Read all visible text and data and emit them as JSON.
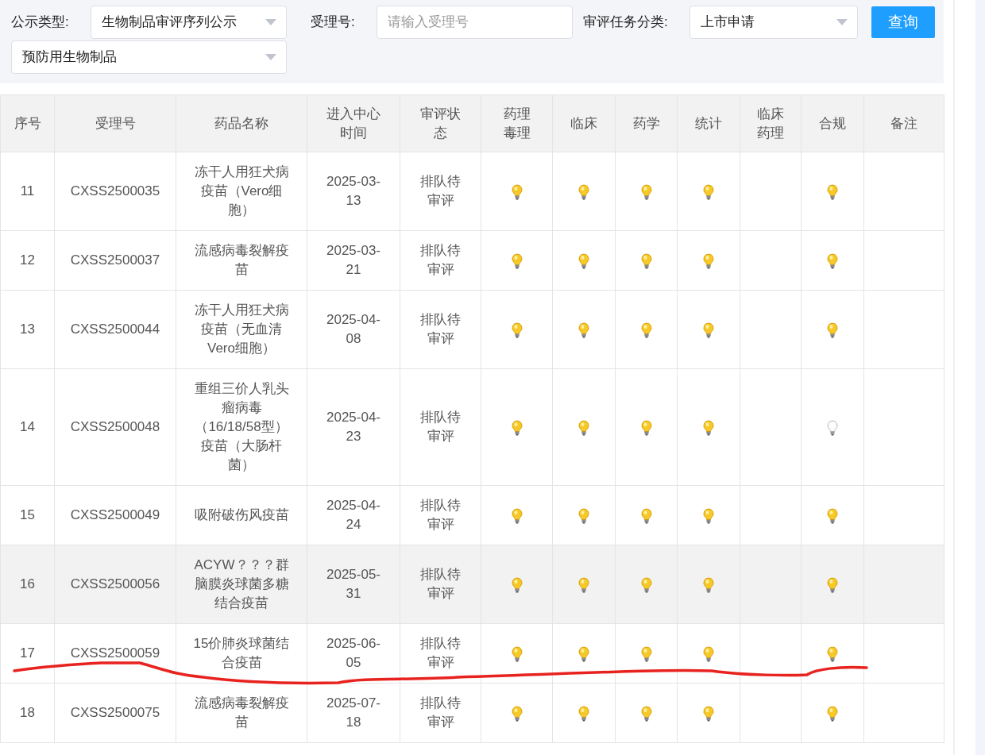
{
  "filters": {
    "notice_type": {
      "label": "公示类型:",
      "value": "生物制品审评序列公示"
    },
    "acceptance_no": {
      "label": "受理号:",
      "placeholder": "请输入受理号"
    },
    "task_category": {
      "label": "审评任务分类:",
      "value": "上市申请"
    },
    "search_button": "查询",
    "subcategory": {
      "value": "预防用生物制品"
    }
  },
  "table": {
    "columns": [
      "序号",
      "受理号",
      "药品名称",
      "进入中心时间",
      "审评状态",
      "药理毒理",
      "临床",
      "药学",
      "统计",
      "临床药理",
      "合规",
      "备注"
    ],
    "rows": [
      {
        "no": "11",
        "acceptance_no": "CXSS2500035",
        "name": "冻干人用狂犬病疫苗（Vero细胞）",
        "date": "2025-03-13",
        "status": "排队待审评",
        "hovered": false,
        "indicators": [
          {
            "kind": "bulb",
            "lit": true
          },
          {
            "kind": "bulb",
            "lit": true
          },
          {
            "kind": "bulb",
            "lit": true
          },
          {
            "kind": "bulb",
            "lit": true
          },
          {
            "kind": "empty"
          },
          {
            "kind": "bulb",
            "lit": true
          }
        ]
      },
      {
        "no": "12",
        "acceptance_no": "CXSS2500037",
        "name": "流感病毒裂解疫苗",
        "date": "2025-03-21",
        "status": "排队待审评",
        "hovered": false,
        "indicators": [
          {
            "kind": "bulb",
            "lit": true
          },
          {
            "kind": "bulb",
            "lit": true
          },
          {
            "kind": "bulb",
            "lit": true
          },
          {
            "kind": "bulb",
            "lit": true
          },
          {
            "kind": "empty"
          },
          {
            "kind": "bulb",
            "lit": true
          }
        ]
      },
      {
        "no": "13",
        "acceptance_no": "CXSS2500044",
        "name": "冻干人用狂犬病疫苗（无血清Vero细胞）",
        "date": "2025-04-08",
        "status": "排队待审评",
        "hovered": false,
        "indicators": [
          {
            "kind": "bulb",
            "lit": true
          },
          {
            "kind": "bulb",
            "lit": true
          },
          {
            "kind": "bulb",
            "lit": true
          },
          {
            "kind": "bulb",
            "lit": true
          },
          {
            "kind": "empty"
          },
          {
            "kind": "bulb",
            "lit": true
          }
        ]
      },
      {
        "no": "14",
        "acceptance_no": "CXSS2500048",
        "name": "重组三价人乳头瘤病毒（16/18/58型）疫苗（大肠杆菌）",
        "date": "2025-04-23",
        "status": "排队待审评",
        "hovered": false,
        "indicators": [
          {
            "kind": "bulb",
            "lit": true
          },
          {
            "kind": "bulb",
            "lit": true
          },
          {
            "kind": "bulb",
            "lit": true
          },
          {
            "kind": "bulb",
            "lit": true
          },
          {
            "kind": "empty"
          },
          {
            "kind": "bulb",
            "lit": false
          }
        ]
      },
      {
        "no": "15",
        "acceptance_no": "CXSS2500049",
        "name": "吸附破伤风疫苗",
        "date": "2025-04-24",
        "status": "排队待审评",
        "hovered": false,
        "indicators": [
          {
            "kind": "bulb",
            "lit": true
          },
          {
            "kind": "bulb",
            "lit": true
          },
          {
            "kind": "bulb",
            "lit": true
          },
          {
            "kind": "bulb",
            "lit": true
          },
          {
            "kind": "empty"
          },
          {
            "kind": "bulb",
            "lit": true
          }
        ]
      },
      {
        "no": "16",
        "acceptance_no": "CXSS2500056",
        "name": "ACYW？？？群脑膜炎球菌多糖结合疫苗",
        "date": "2025-05-31",
        "status": "排队待审评",
        "hovered": true,
        "indicators": [
          {
            "kind": "bulb",
            "lit": true
          },
          {
            "kind": "bulb",
            "lit": true
          },
          {
            "kind": "bulb",
            "lit": true
          },
          {
            "kind": "bulb",
            "lit": true
          },
          {
            "kind": "empty"
          },
          {
            "kind": "bulb",
            "lit": true
          }
        ]
      },
      {
        "no": "17",
        "acceptance_no": "CXSS2500059",
        "name": "15价肺炎球菌结合疫苗",
        "date": "2025-06-05",
        "status": "排队待审评",
        "hovered": false,
        "indicators": [
          {
            "kind": "bulb",
            "lit": true
          },
          {
            "kind": "bulb",
            "lit": true
          },
          {
            "kind": "bulb",
            "lit": true
          },
          {
            "kind": "bulb",
            "lit": true
          },
          {
            "kind": "empty"
          },
          {
            "kind": "bulb",
            "lit": true
          }
        ]
      },
      {
        "no": "18",
        "acceptance_no": "CXSS2500075",
        "name": "流感病毒裂解疫苗",
        "date": "2025-07-18",
        "status": "排队待审评",
        "hovered": false,
        "indicators": [
          {
            "kind": "bulb",
            "lit": true
          },
          {
            "kind": "bulb",
            "lit": true
          },
          {
            "kind": "bulb",
            "lit": true
          },
          {
            "kind": "bulb",
            "lit": true
          },
          {
            "kind": "empty"
          },
          {
            "kind": "bulb",
            "lit": true
          }
        ]
      }
    ]
  }
}
